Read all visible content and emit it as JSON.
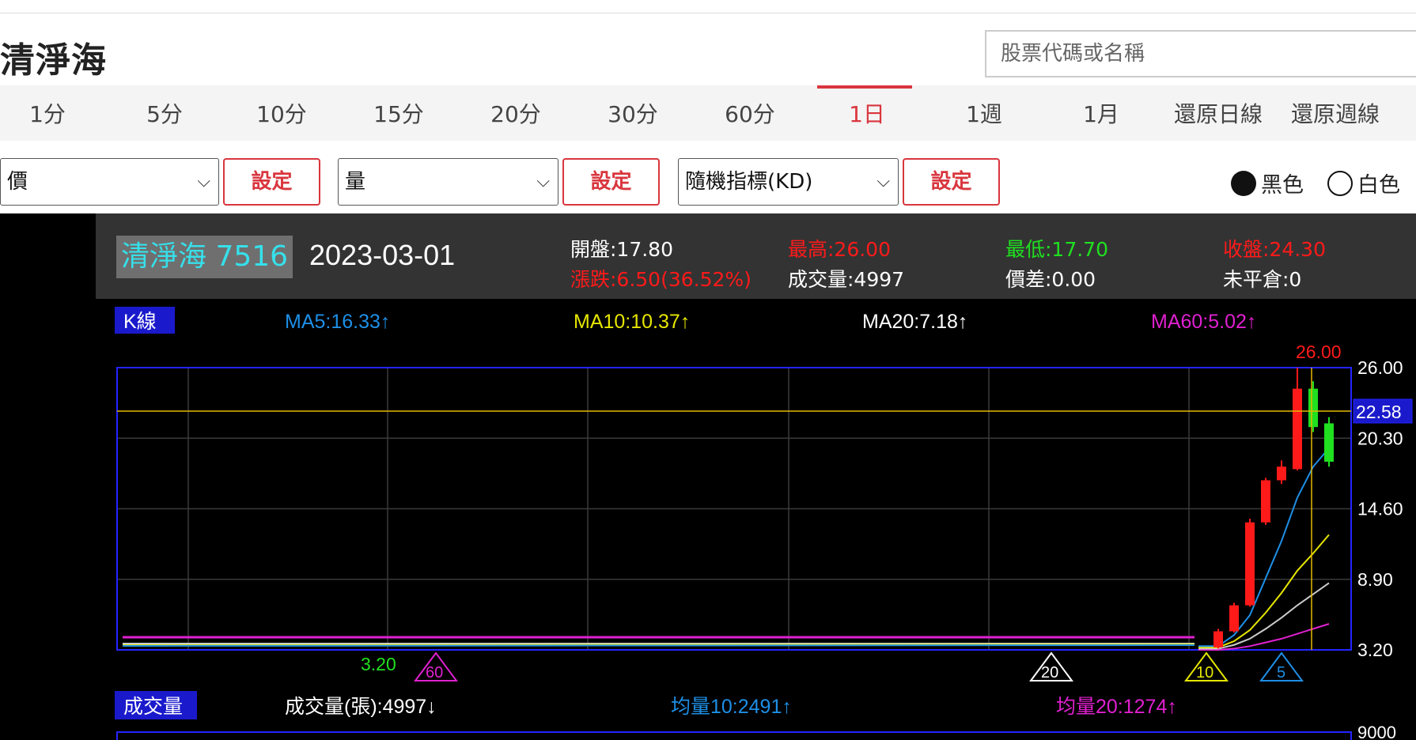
{
  "page": {
    "title": "清淨海",
    "search_placeholder": "股票代碼或名稱"
  },
  "tabs": [
    {
      "label": "1分",
      "active": false
    },
    {
      "label": "5分",
      "active": false
    },
    {
      "label": "10分",
      "active": false
    },
    {
      "label": "15分",
      "active": false
    },
    {
      "label": "20分",
      "active": false
    },
    {
      "label": "30分",
      "active": false
    },
    {
      "label": "60分",
      "active": false
    },
    {
      "label": "1日",
      "active": true
    },
    {
      "label": "1週",
      "active": false
    },
    {
      "label": "1月",
      "active": false
    },
    {
      "label": "還原日線",
      "active": false
    },
    {
      "label": "還原週線",
      "active": false
    },
    {
      "label": "還",
      "active": false
    }
  ],
  "controls": {
    "price_select": "價",
    "volume_select": "量",
    "indicator_select": "隨機指標(KD)",
    "set_label": "設定",
    "theme_black": "黑色",
    "theme_white": "白色",
    "theme_selected": "black",
    "chevron": "⌵"
  },
  "info": {
    "stock": "清淨海 7516",
    "date": "2023-03-01",
    "open": "開盤:17.80",
    "high": "最高:26.00",
    "low": "最低:17.70",
    "close": "收盤:24.30",
    "change": "漲跌:6.50(36.52%)",
    "volume": "成交量:4997",
    "spread": "價差:0.00",
    "open_interest": "未平倉:0"
  },
  "kline": {
    "label": "K線",
    "ma5": "MA5:16.33↑",
    "ma10": "MA10:10.37↑",
    "ma20": "MA20:7.18↑",
    "ma60": "MA60:5.02↑",
    "high_label": "26.00",
    "low_label": "3.20",
    "cursor_value": "22.58",
    "markers": [
      "60",
      "20",
      "10",
      "5"
    ]
  },
  "volume_panel": {
    "label": "成交量",
    "vol": "成交量(張):4997↓",
    "avg10": "均量10:2491↑",
    "avg20": "均量20:1274↑",
    "axis_top": "9000"
  },
  "colors": {
    "up": "#ff1a1a",
    "down": "#20e020",
    "ma5": "#1e8fe6",
    "ma10": "#e6e600",
    "ma20": "#cccccc",
    "ma60": "#e020d0",
    "cursor": "#e6b800",
    "accent": "#d9363e"
  },
  "chart_data": {
    "type": "candlestick",
    "ylim": [
      3.2,
      26.0
    ],
    "yticks": [
      "26.00",
      "20.30",
      "14.60",
      "8.90",
      "3.20"
    ],
    "candles": [
      {
        "open": 3.4,
        "close": 4.7,
        "high": 4.9,
        "low": 3.3
      },
      {
        "open": 4.7,
        "close": 6.8,
        "high": 7.0,
        "low": 4.6
      },
      {
        "open": 6.8,
        "close": 13.5,
        "high": 13.8,
        "low": 6.7
      },
      {
        "open": 13.5,
        "close": 16.9,
        "high": 17.1,
        "low": 13.3
      },
      {
        "open": 16.9,
        "close": 18.0,
        "high": 18.5,
        "low": 16.6
      },
      {
        "open": 17.8,
        "close": 24.3,
        "high": 26.0,
        "low": 17.7
      },
      {
        "open": 24.3,
        "close": 21.2,
        "high": 24.9,
        "low": 20.8
      },
      {
        "open": 21.5,
        "close": 18.4,
        "high": 22.0,
        "low": 18.0
      }
    ],
    "ma5": [
      3.5,
      4.4,
      6.0,
      9.0,
      12.0,
      15.5,
      18.0,
      19.5
    ],
    "ma10": [
      3.4,
      3.9,
      4.8,
      6.2,
      7.8,
      9.6,
      11.0,
      12.5
    ],
    "ma20": [
      3.3,
      3.6,
      4.1,
      4.9,
      5.8,
      6.8,
      7.7,
      8.6
    ],
    "ma60": [
      3.2,
      3.3,
      3.5,
      3.8,
      4.1,
      4.5,
      4.9,
      5.3
    ]
  }
}
